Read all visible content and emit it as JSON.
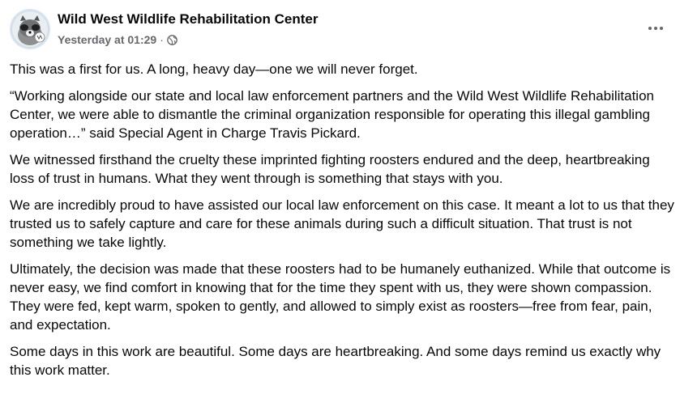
{
  "post": {
    "page_name": "Wild West Wildlife Rehabilitation Center",
    "timestamp": "Yesterday at 01:29",
    "separator": "·",
    "audience_icon": "globe-icon",
    "more_icon": "more-options-icon",
    "paragraphs": [
      "This was a first for us. A long, heavy day—one we will never forget.",
      "“Working alongside our state and local law enforcement partners and the Wild West Wildlife Rehabilitation Center, we were able to dismantle the criminal organization responsible for operating this illegal gambling operation…” said Special Agent in Charge Travis Pickard.",
      "We witnessed firsthand the cruelty these imprinted  fighting roosters endured and the deep, heartbreaking loss of trust in humans. What they went through is something that stays with you.",
      "We are incredibly proud to have assisted our local law enforcement on this case. It meant a lot to us that they trusted us to safely capture and care for these animals during such a difficult situation. That trust is not something we take lightly.",
      "Ultimately, the decision was made that these roosters had to be humanely euthanized. While that outcome is never easy, we find comfort in knowing that for the time they spent with us, they were shown compassion. They were fed, kept warm, spoken to gently, and allowed to simply exist as roosters—free from fear, pain, and expectation.",
      "Some days in this work are beautiful. Some days are heartbreaking. And some days remind us exactly why this work matter."
    ]
  },
  "colors": {
    "text_primary": "#080809",
    "text_secondary": "#65676b",
    "avatar_ring": "#d7e4f5"
  }
}
